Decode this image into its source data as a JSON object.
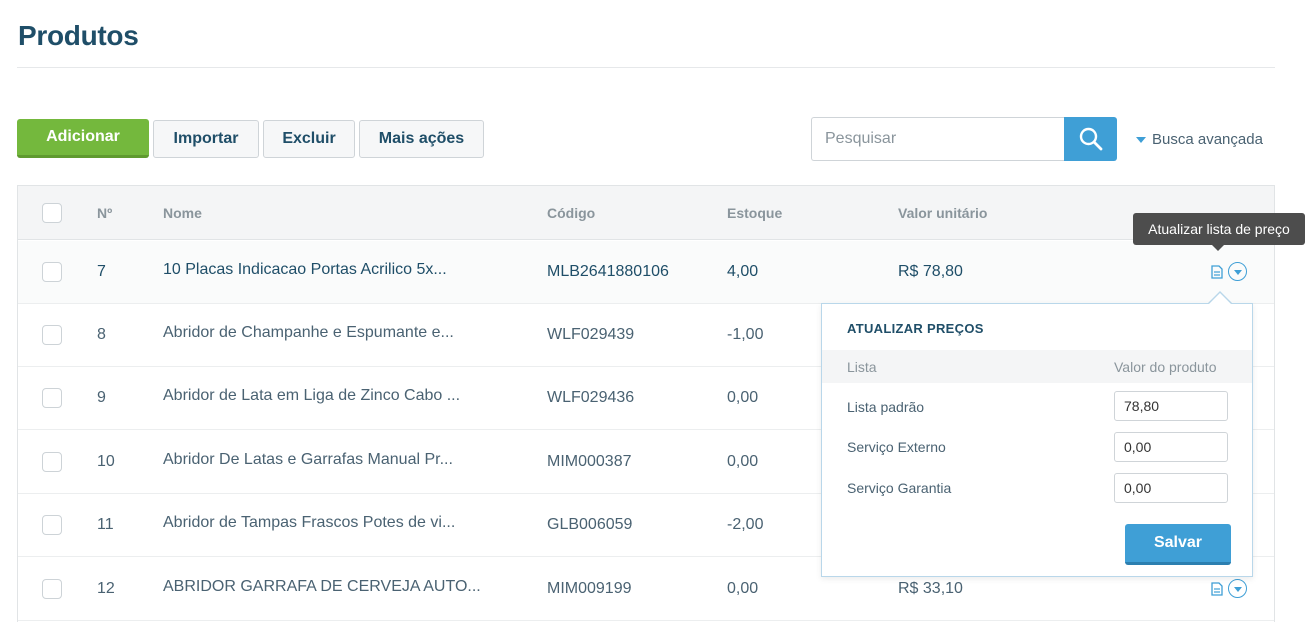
{
  "page": {
    "title": "Produtos"
  },
  "toolbar": {
    "add_label": "Adicionar",
    "import_label": "Importar",
    "delete_label": "Excluir",
    "more_label": "Mais ações"
  },
  "search": {
    "placeholder": "Pesquisar",
    "value": "",
    "advanced_label": "Busca avançada"
  },
  "table": {
    "headers": {
      "number": "Nº",
      "name": "Nome",
      "code": "Código",
      "stock": "Estoque",
      "unit_value": "Valor unitário"
    },
    "rows": [
      {
        "number": "7",
        "name": "10 Placas Indicacao Portas Acrilico 5x...",
        "code": "MLB2641880106",
        "stock": "4,00",
        "unit_value": "R$ 78,80"
      },
      {
        "number": "8",
        "name": "Abridor de Champanhe e Espumante e...",
        "code": "WLF029439",
        "stock": "-1,00",
        "unit_value": ""
      },
      {
        "number": "9",
        "name": "Abridor de Lata em Liga de Zinco Cabo ...",
        "code": "WLF029436",
        "stock": "0,00",
        "unit_value": ""
      },
      {
        "number": "10",
        "name": "Abridor De Latas e Garrafas Manual Pr...",
        "code": "MIM000387",
        "stock": "0,00",
        "unit_value": ""
      },
      {
        "number": "11",
        "name": "Abridor de Tampas Frascos Potes de vi...",
        "code": "GLB006059",
        "stock": "-2,00",
        "unit_value": ""
      },
      {
        "number": "12",
        "name": "ABRIDOR GARRAFA DE CERVEJA AUTO...",
        "code": "MIM009199",
        "stock": "0,00",
        "unit_value": "R$ 33,10"
      }
    ]
  },
  "tooltip": {
    "text": "Atualizar lista de preço"
  },
  "price_popup": {
    "title": "ATUALIZAR PREÇOS",
    "col_list": "Lista",
    "col_value": "Valor do produto",
    "entries": [
      {
        "label": "Lista padrão",
        "value": "78,80"
      },
      {
        "label": "Serviço Externo",
        "value": "0,00"
      },
      {
        "label": "Serviço Garantia",
        "value": "0,00"
      }
    ],
    "save_label": "Salvar"
  },
  "colors": {
    "accent_green": "#74b83d",
    "accent_blue": "#3f9fd6",
    "title_navy": "#1f4e68"
  },
  "icons": {
    "search": "search-icon",
    "advanced": "caret-down-icon",
    "row_doc": "document-icon",
    "row_menu": "chevron-circle-down-icon"
  }
}
